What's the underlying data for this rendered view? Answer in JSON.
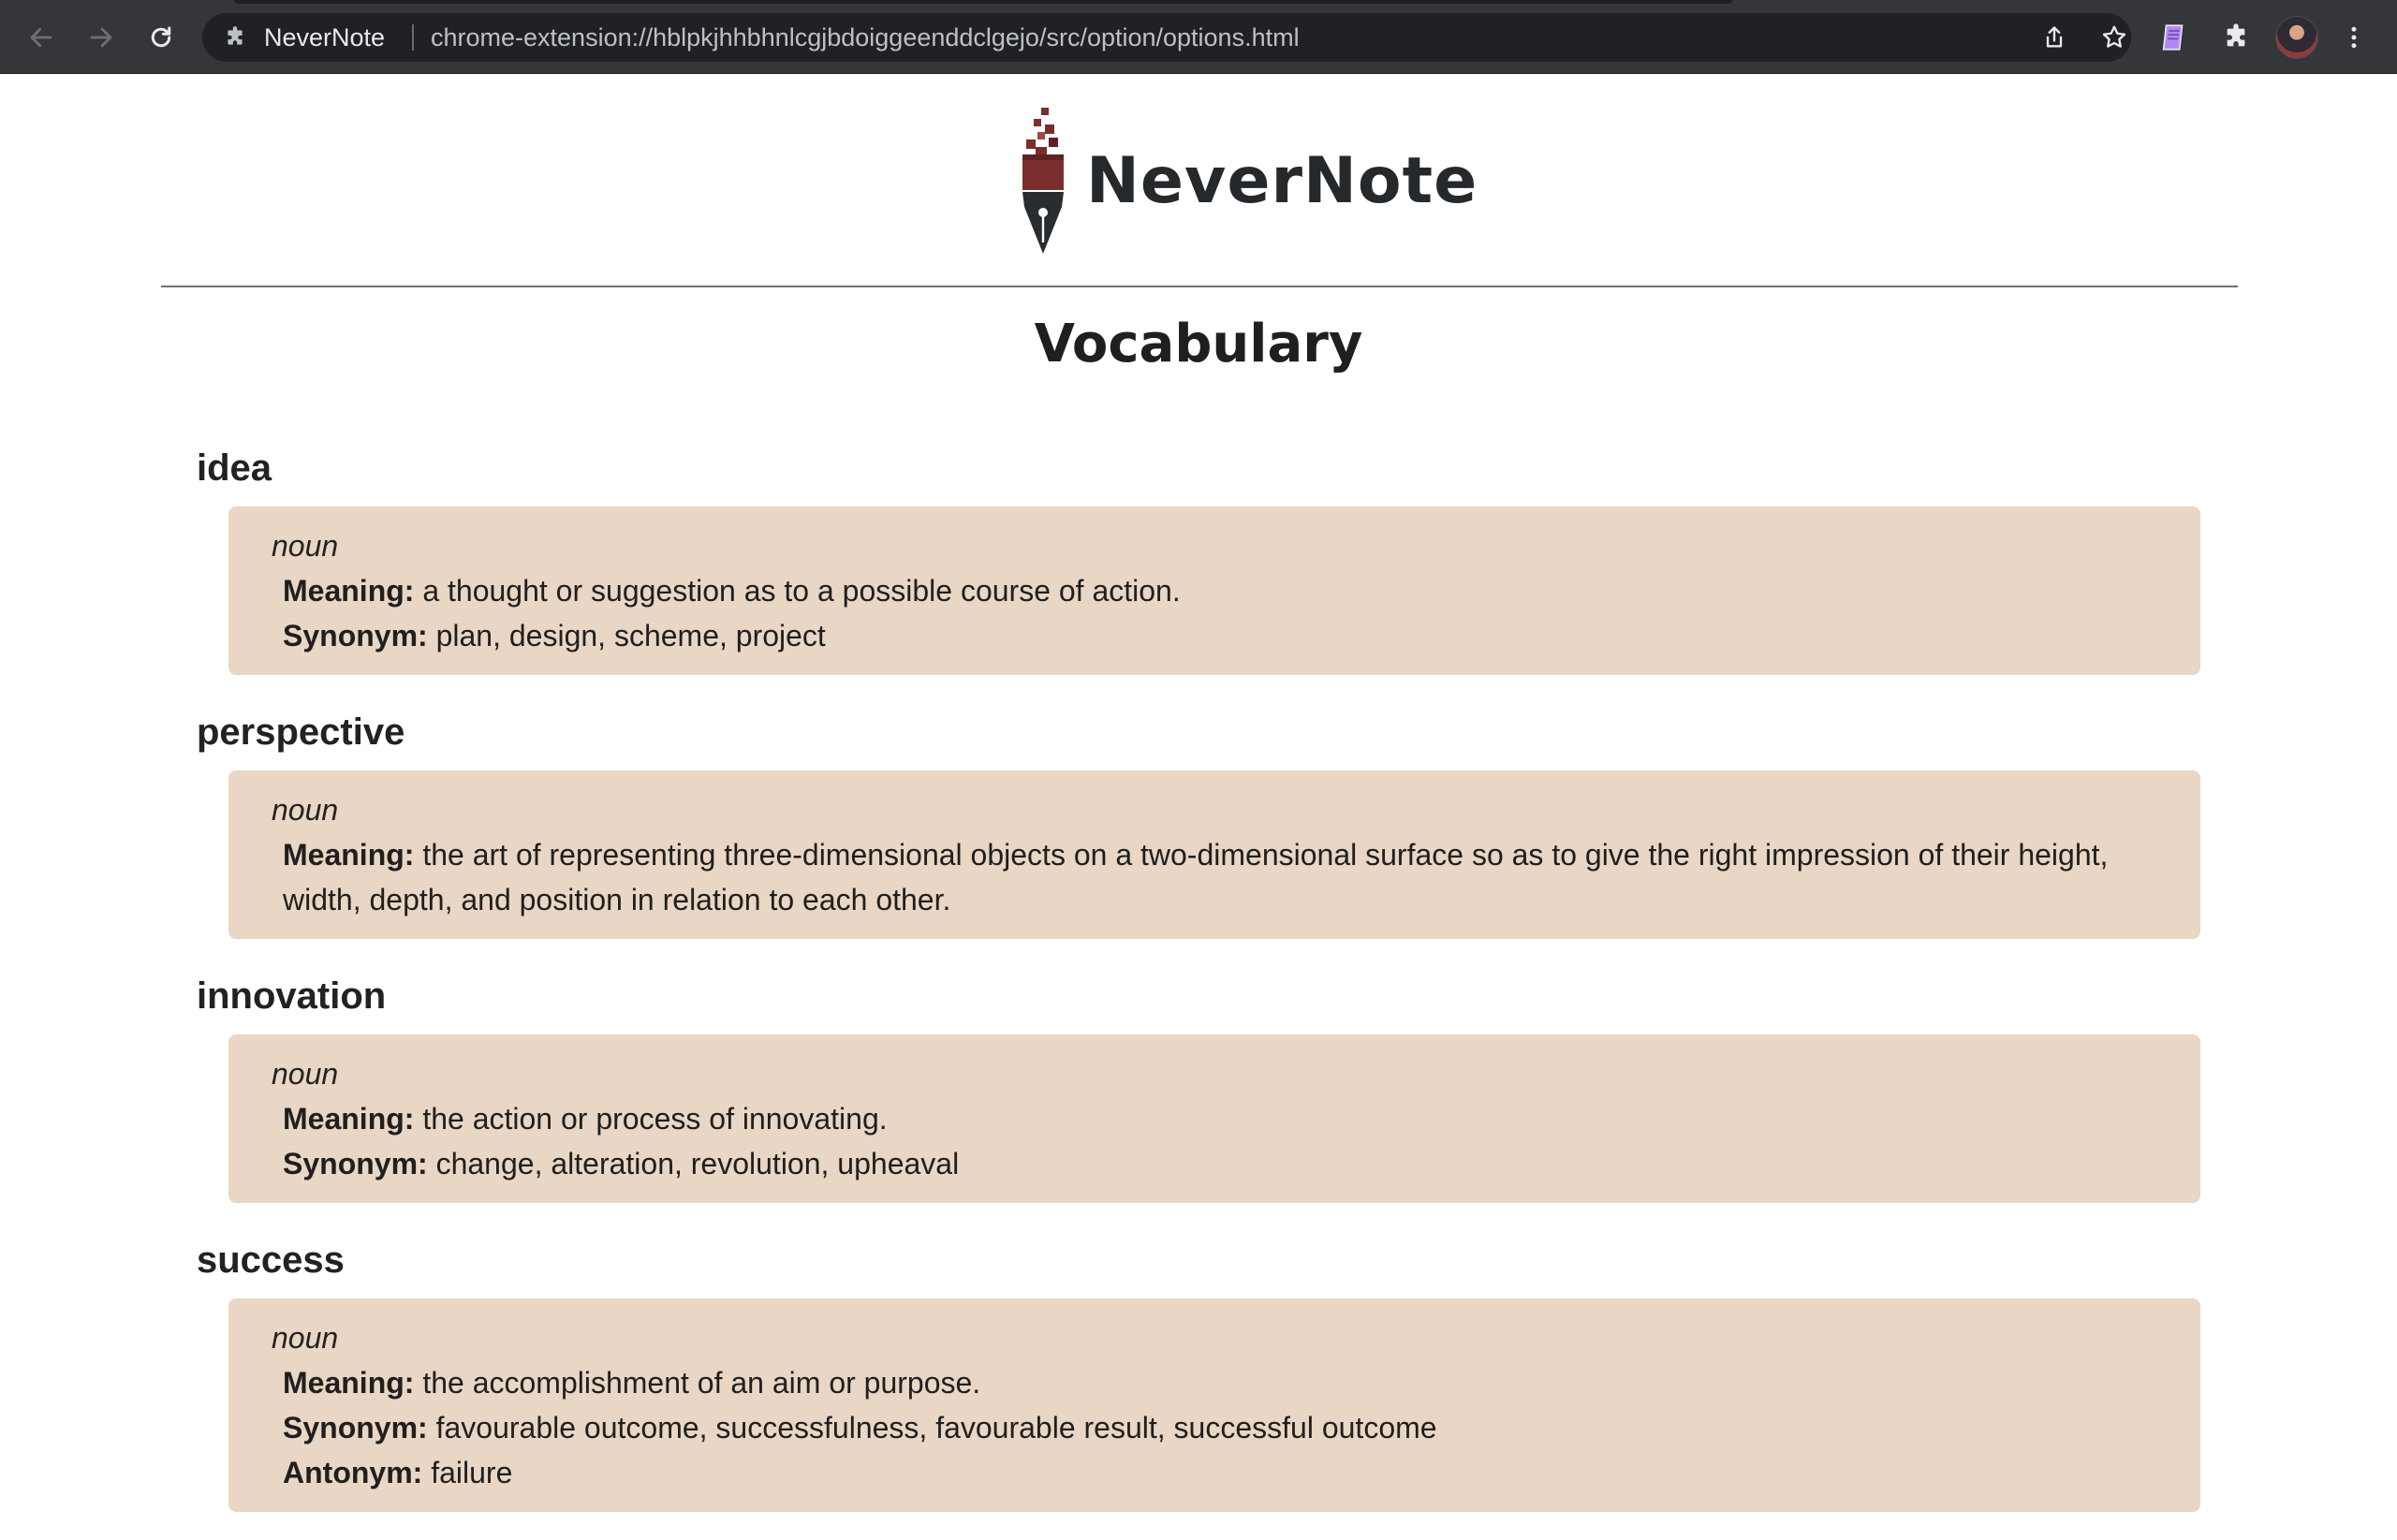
{
  "browser": {
    "site_name": "NeverNote",
    "url": "chrome-extension://hblpkjhhbhnlcgjbdoiggeenddclgejo/src/option/options.html",
    "icons": {
      "back": "back-arrow-icon",
      "forward": "forward-arrow-icon",
      "reload": "reload-icon",
      "extension": "puzzle-piece-icon",
      "share": "share-icon",
      "bookmark": "star-icon",
      "nevernote_ext": "notebook-icon",
      "extensions_menu": "puzzle-piece-icon",
      "profile": "avatar",
      "menu": "kebab-menu-icon"
    }
  },
  "header": {
    "brand_name": "NeverNote",
    "page_title": "Vocabulary"
  },
  "labels": {
    "meaning": "Meaning:",
    "synonym": "Synonym:",
    "antonym": "Antonym:"
  },
  "vocab": [
    {
      "word": "idea",
      "pos": "noun",
      "meaning": "a thought or suggestion as to a possible course of action.",
      "synonym": "plan, design, scheme, project"
    },
    {
      "word": "perspective",
      "pos": "noun",
      "meaning": "the art of representing three-dimensional objects on a two-dimensional surface so as to give the right impression of their height, width, depth, and position in relation to each other."
    },
    {
      "word": "innovation",
      "pos": "noun",
      "meaning": "the action or process of innovating.",
      "synonym": "change, alteration, revolution, upheaval"
    },
    {
      "word": "success",
      "pos": "noun",
      "meaning": "the accomplishment of an aim or purpose.",
      "synonym": "favourable outcome, successfulness, favourable result, successful outcome",
      "antonym": "failure"
    }
  ],
  "colors": {
    "chrome_bg": "#35363a",
    "omnibox_bg": "#202124",
    "card_bg": "#e9d6c4",
    "brand_text": "#26292c",
    "logo_red": "#7a2e2b"
  }
}
